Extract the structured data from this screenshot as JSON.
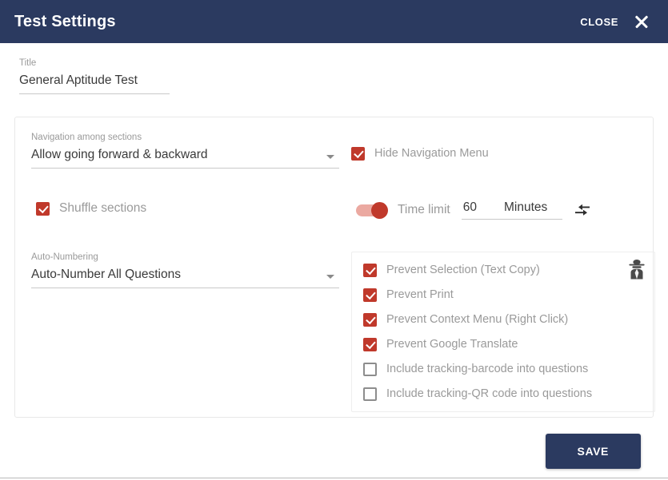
{
  "header": {
    "title": "Test Settings",
    "close_label": "CLOSE",
    "close_icon": "close-icon",
    "background": "#2b3a60"
  },
  "title_field": {
    "label": "Title",
    "value": "General Aptitude Test"
  },
  "navigation": {
    "label": "Navigation among sections",
    "value": "Allow going forward & backward",
    "caret_icon": "chevron-down-icon"
  },
  "hide_navigation_menu": {
    "label": "Hide Navigation Menu",
    "checked": true
  },
  "shuffle_sections": {
    "label": "Shuffle sections",
    "checked": true
  },
  "time_limit": {
    "toggle_on": true,
    "label": "Time limit",
    "value": "60",
    "unit": "Minutes",
    "icon": "collapse-arrows-icon"
  },
  "auto_numbering": {
    "label": "Auto-Numbering",
    "value": "Auto-Number All Questions",
    "caret_icon": "chevron-down-icon"
  },
  "security": {
    "icon": "spy-icon",
    "options": [
      {
        "label": "Prevent Selection (Text Copy)",
        "checked": true
      },
      {
        "label": "Prevent Print",
        "checked": true
      },
      {
        "label": "Prevent Context Menu (Right Click)",
        "checked": true
      },
      {
        "label": "Prevent Google Translate",
        "checked": true
      },
      {
        "label": "Include tracking-barcode into questions",
        "checked": false
      },
      {
        "label": "Include tracking-QR code into questions",
        "checked": false
      }
    ]
  },
  "footer": {
    "save_label": "SAVE"
  },
  "colors": {
    "header_bg": "#2b3a60",
    "accent_red": "#c0392b",
    "toggle_track": "#eba9a1",
    "muted_text": "#9a9a9a",
    "value_text": "#3a3a3a"
  }
}
